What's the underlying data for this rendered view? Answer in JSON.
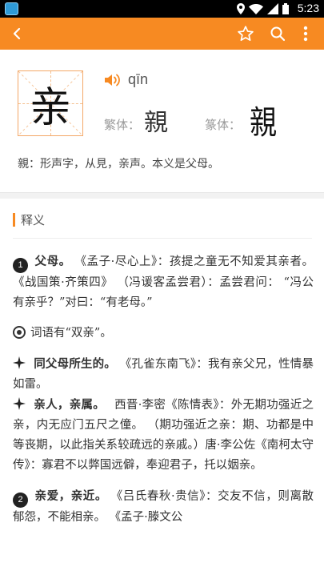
{
  "status_bar": {
    "time": "5:23"
  },
  "header": {
    "character": "亲",
    "pinyin": "qīn",
    "traditional_label": "繁体：",
    "traditional_char": "親",
    "seal_label": "篆体：",
    "seal_char": "親",
    "etymology": "親：形声字，从見，亲声。本义是父母。"
  },
  "section": {
    "title": "释义"
  },
  "definitions": [
    {
      "marker": "1",
      "keyword": "父母。",
      "text": "《孟子·尽心上》：孩提之童无不知爱其亲者。 《战国策·齐策四》 （冯谖客孟尝君）：孟尝君问： “冯公有亲乎？”对曰：“有老母。”"
    },
    {
      "note": "词语有“双亲”。"
    },
    {
      "keyword": "同父母所生的。",
      "text": "《孔雀东南飞》：我有亲父兄，性情暴如雷。"
    },
    {
      "keyword": "亲人，亲属。",
      "text": "西晋·李密《陈情表》：外无期功强近之亲，内无应门五尺之僮。 （期功强近之亲：期、功都是中等丧期，以此指关系较疏远的亲戚。）唐·李公佐《南柯太守传》：寡君不以弊国远僻，奉迎君子，托以姻亲。"
    },
    {
      "marker": "2",
      "keyword": "亲爱，亲近。",
      "text": "《吕氏春秋·贵信》：交友不信，则离散郁怨，不能相亲。 《孟子·滕文公"
    }
  ]
}
